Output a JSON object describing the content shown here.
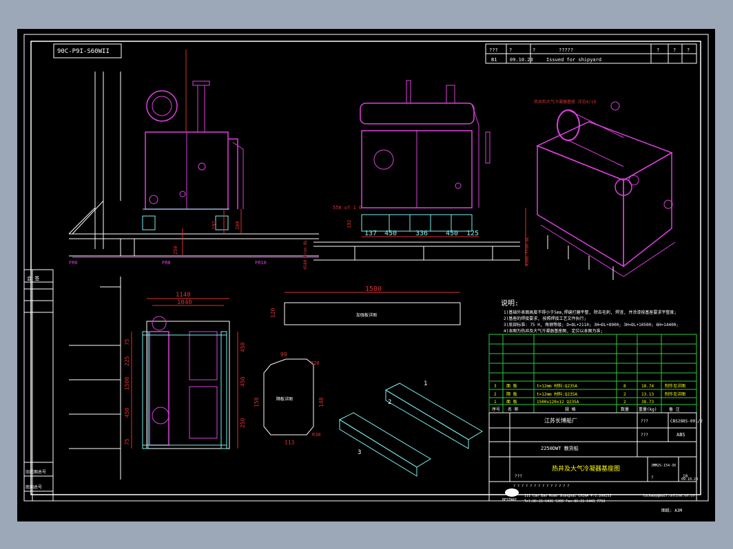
{
  "drawing": {
    "code_box": "90C-P9I-S60WII",
    "revision": {
      "header": [
        "???",
        "?",
        "?",
        "?????",
        "?",
        "?",
        "?"
      ],
      "row": {
        "rev": "B1",
        "date": "09.10.23",
        "desc": "Issued for shipyard"
      }
    },
    "notes_title": "说明:",
    "notes": [
      "1)基础外表面高度不得小于5mm,焊缝打磨平整, 除去毛刺, 焊渣, 并涂漆按基座要求平整度;",
      "2)基座的焊接要求, 按照焊接工艺文件执行;",
      "3)底部标准: 75 H, 角钢等级; D=DL+2110; 3H=DL+8900; 3H=DL+10500; 6H=14400;",
      "4)本图为热井及大气冷凝器基座图, 定位以本图为准;"
    ],
    "bom_rows": [
      {
        "no": "3",
        "name": "面 板",
        "spec": "t=12mm 材料:Q235A",
        "qty": "8",
        "weight": "18.74",
        "note": "制作见详图"
      },
      {
        "no": "2",
        "name": "隔 板",
        "spec": "t=12mm 材料:Q235A",
        "qty": "2",
        "weight": "13.13",
        "note": "制作见详图"
      },
      {
        "no": "1",
        "name": "面 板",
        "spec": "1500x120x12 Q235A",
        "qty": "2",
        "weight": "38.73",
        "note": ""
      }
    ],
    "bom_header": {
      "no": "序号",
      "name": "名 称",
      "spec": "规 格",
      "qty": "数量",
      "weight": "重量(kg)",
      "note": "备 注"
    },
    "title_block": {
      "company": "江苏长博船厂",
      "drawing_no": "CBS288S-001/2",
      "class": "ABS",
      "ship_type": "2250DWT 散货船",
      "doc_no": "JMM2S-154-3X",
      "title": "热井及大气冷凝器基座图",
      "page": "?",
      "scale_label": "Scale",
      "date": "09.10.23",
      "mark_small": "10",
      "qm": "???",
      "qm_row": "? ? ? ? ? ? ? ? ? ? ? ? ? ?"
    },
    "logo_text": "BESTWAY",
    "address_line": "111 Cao Bao Road Shanghai CHINA   P.C.200233",
    "contact_line": "Tel:86-21-6436 5300  Fax:86-21-6443 7760",
    "email": "luckway@mail.online.sh.cn",
    "sheet_size": "图纸: A3M",
    "side_labels": {
      "top": "会 签",
      "mid": "旧底图总号",
      "bot": "底图总号"
    },
    "frame_labels": [
      "FR6",
      "FR8",
      "FR10"
    ],
    "dims": {
      "top_width": "1140",
      "inner_width": "1040",
      "plate_len": "1500",
      "plate_h": "120",
      "front_dims": [
        "137",
        "450",
        "336",
        "450",
        "125"
      ],
      "side_left": [
        "75",
        "225",
        "450",
        "1500",
        "450",
        "225",
        "75"
      ],
      "side_right": [
        "75",
        "250",
        "450",
        "450",
        "250",
        "75"
      ],
      "plate_dims": [
        "99",
        "R20",
        "R30",
        "158",
        "148",
        "113"
      ],
      "heights": [
        "200",
        "192",
        "192",
        "550 of 1 0",
        "250",
        "50"
      ],
      "elev": "4580 from BL"
    },
    "part_labels": [
      "1",
      "2",
      "3"
    ],
    "plate_text": "加强板详图",
    "plate_text2": "隔板详图",
    "iso_note": "热井和大气冷凝器基座 详见4/10"
  }
}
